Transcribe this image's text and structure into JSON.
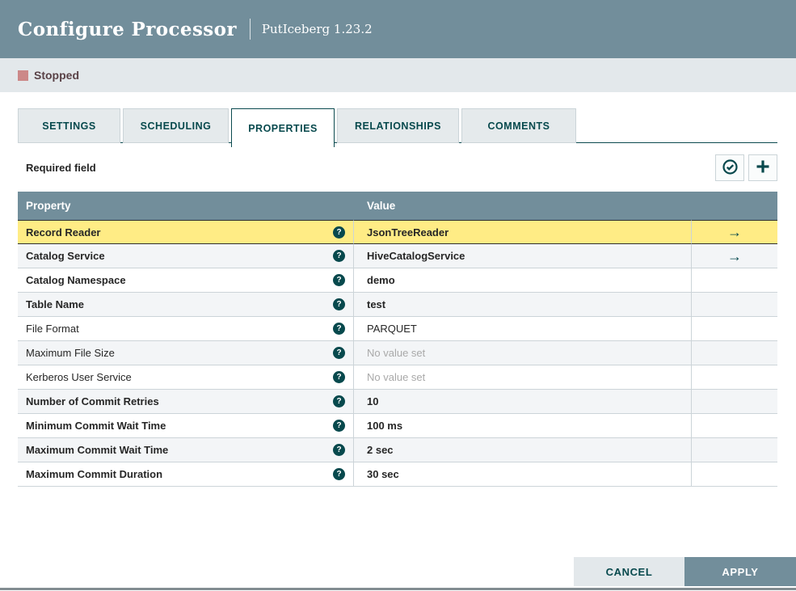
{
  "dialog": {
    "title": "Configure Processor",
    "subtitle": "PutIceberg 1.23.2",
    "status_label": "Stopped"
  },
  "tabs": [
    "SETTINGS",
    "SCHEDULING",
    "PROPERTIES",
    "RELATIONSHIPS",
    "COMMENTS"
  ],
  "active_tab": "PROPERTIES",
  "panel": {
    "required_field_label": "Required field",
    "verify_button_icon": "check-circle-icon",
    "add_button_icon": "plus-icon",
    "table": {
      "columns": [
        "Property",
        "Value"
      ],
      "rows": [
        {
          "property": "Record Reader",
          "value": "JsonTreeReader",
          "required": true,
          "selected": true,
          "unset": false,
          "has_goto": true
        },
        {
          "property": "Catalog Service",
          "value": "HiveCatalogService",
          "required": true,
          "selected": false,
          "unset": false,
          "has_goto": true
        },
        {
          "property": "Catalog Namespace",
          "value": "demo",
          "required": true,
          "selected": false,
          "unset": false,
          "has_goto": false
        },
        {
          "property": "Table Name",
          "value": "test",
          "required": true,
          "selected": false,
          "unset": false,
          "has_goto": false
        },
        {
          "property": "File Format",
          "value": "PARQUET",
          "required": false,
          "selected": false,
          "unset": false,
          "has_goto": false
        },
        {
          "property": "Maximum File Size",
          "value": "No value set",
          "required": false,
          "selected": false,
          "unset": true,
          "has_goto": false
        },
        {
          "property": "Kerberos User Service",
          "value": "No value set",
          "required": false,
          "selected": false,
          "unset": true,
          "has_goto": false
        },
        {
          "property": "Number of Commit Retries",
          "value": "10",
          "required": true,
          "selected": false,
          "unset": false,
          "has_goto": false
        },
        {
          "property": "Minimum Commit Wait Time",
          "value": "100 ms",
          "required": true,
          "selected": false,
          "unset": false,
          "has_goto": false
        },
        {
          "property": "Maximum Commit Wait Time",
          "value": "2 sec",
          "required": true,
          "selected": false,
          "unset": false,
          "has_goto": false
        },
        {
          "property": "Maximum Commit Duration",
          "value": "30 sec",
          "required": true,
          "selected": false,
          "unset": false,
          "has_goto": false
        }
      ]
    }
  },
  "footer": {
    "cancel_label": "CANCEL",
    "apply_label": "APPLY"
  },
  "colors": {
    "header_slate": "#728e9b",
    "light_gray_bar": "#e3e8eb",
    "teal_accent": "#07494d",
    "selected_row_yellow": "#ffec85",
    "alt_row_gray": "#f3f5f7",
    "stopped_red": "#cc8888"
  }
}
